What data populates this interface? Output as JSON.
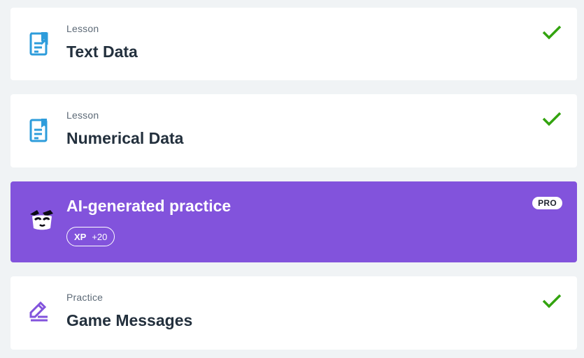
{
  "items": [
    {
      "kind": "Lesson",
      "title": "Text Data",
      "icon": "lesson-book-icon",
      "completed": true
    },
    {
      "kind": "Lesson",
      "title": "Numerical Data",
      "icon": "lesson-book-icon",
      "completed": true
    },
    {
      "title": "AI-generated practice",
      "icon": "ai-mascot-icon",
      "badge": "PRO",
      "xp_label": "XP",
      "xp_value": "+20",
      "accent": "#8253dc"
    },
    {
      "kind": "Practice",
      "title": "Game Messages",
      "icon": "practice-pencil-icon",
      "completed": true
    }
  ],
  "colors": {
    "check": "#33a30f",
    "lesson_icon": "#2d9cdb",
    "practice_icon": "#8253dc",
    "background": "#f0f3f5"
  }
}
